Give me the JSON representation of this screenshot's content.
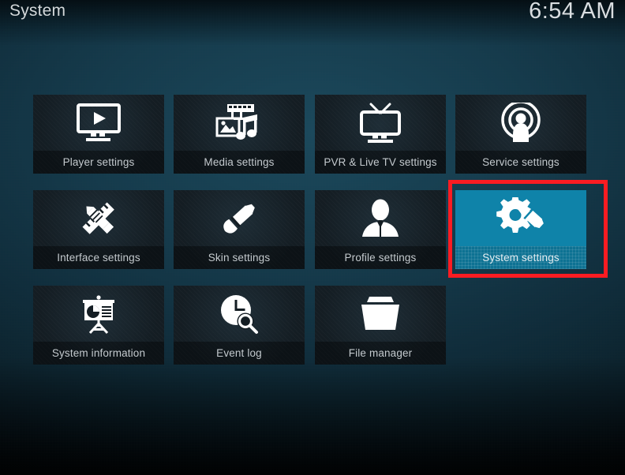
{
  "header": {
    "title": "System",
    "clock": "6:54 AM"
  },
  "colors": {
    "selection_highlight": "#0f83a9",
    "annotation_border": "#fb1c22",
    "tile_background": "#141d23",
    "label_text": "#c4cace",
    "header_text": "#d3d8da",
    "background_top": "#19475a",
    "background_bottom": "#040c11"
  },
  "menu": {
    "rows": [
      {
        "tiles": [
          {
            "label": "Player settings",
            "icon": "tv-play-icon",
            "selected": false
          },
          {
            "label": "Media settings",
            "icon": "film-photo-music-icon",
            "selected": false
          },
          {
            "label": "PVR & Live TV settings",
            "icon": "tv-antenna-icon",
            "selected": false
          },
          {
            "label": "Service settings",
            "icon": "broadcast-person-icon",
            "selected": false
          }
        ]
      },
      {
        "tiles": [
          {
            "label": "Interface settings",
            "icon": "pencil-ruler-icon",
            "selected": false
          },
          {
            "label": "Skin settings",
            "icon": "paintbrush-icon",
            "selected": false
          },
          {
            "label": "Profile settings",
            "icon": "person-bust-icon",
            "selected": false
          },
          {
            "label": "System settings",
            "icon": "gear-screwdriver-icon",
            "selected": true
          }
        ]
      },
      {
        "tiles": [
          {
            "label": "System information",
            "icon": "presentation-chart-icon",
            "selected": false
          },
          {
            "label": "Event log",
            "icon": "clock-search-icon",
            "selected": false
          },
          {
            "label": "File manager",
            "icon": "folder-icon",
            "selected": false
          }
        ]
      }
    ]
  },
  "annotation": {
    "target_label": "System settings",
    "shape": "rectangle"
  }
}
